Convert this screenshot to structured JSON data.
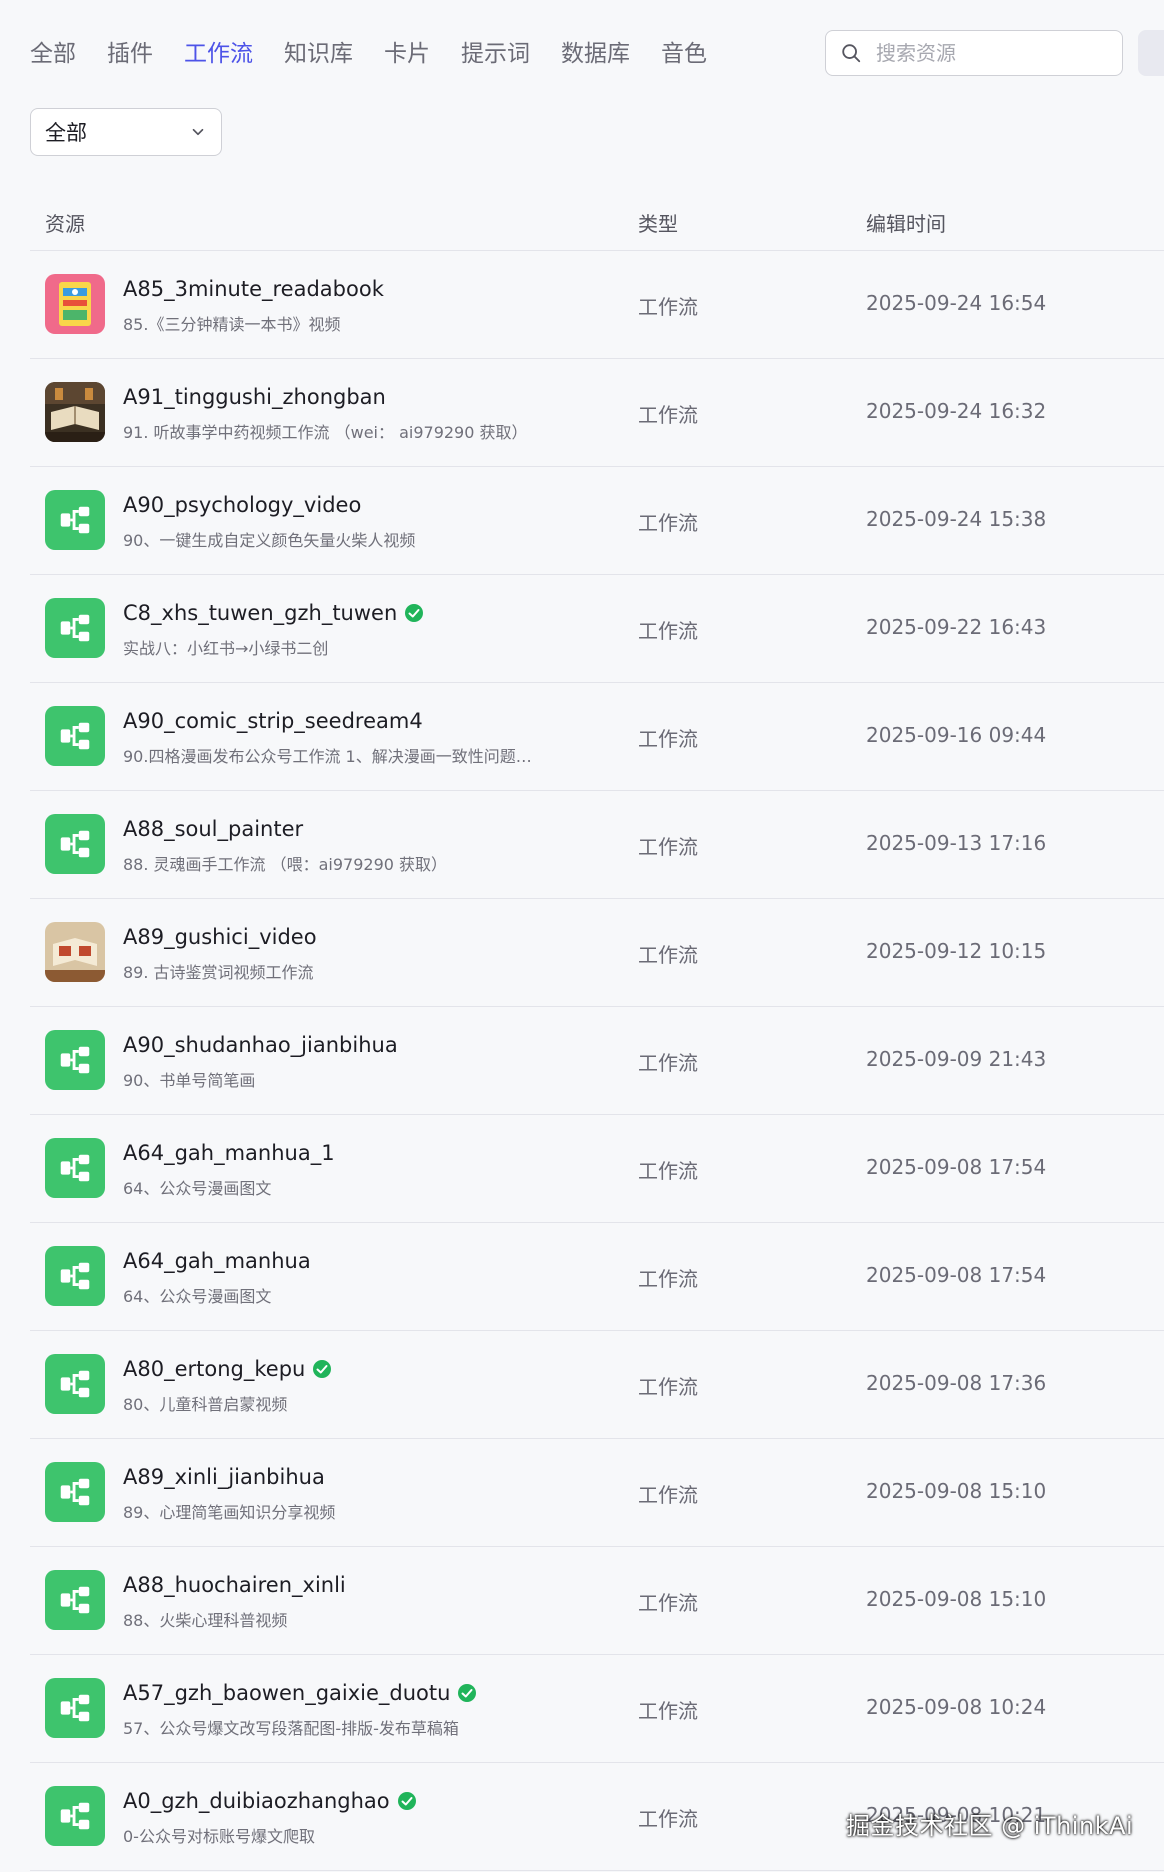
{
  "tabs": [
    {
      "label": "全部",
      "active": false
    },
    {
      "label": "插件",
      "active": false
    },
    {
      "label": "工作流",
      "active": true
    },
    {
      "label": "知识库",
      "active": false
    },
    {
      "label": "卡片",
      "active": false
    },
    {
      "label": "提示词",
      "active": false
    },
    {
      "label": "数据库",
      "active": false
    },
    {
      "label": "音色",
      "active": false
    }
  ],
  "search": {
    "placeholder": "搜索资源",
    "value": ""
  },
  "filter": {
    "selected": "全部"
  },
  "table": {
    "headers": {
      "resource": "资源",
      "type": "类型",
      "edit_time": "编辑时间"
    },
    "rows": [
      {
        "title": "A85_3minute_readabook",
        "desc": "85.《三分钟精读一本书》视频",
        "type": "工作流",
        "time": "2025-09-24 16:54",
        "icon": "book-thumbnail",
        "verified": false
      },
      {
        "title": "A91_tinggushi_zhongban",
        "desc": "91. 听故事学中药视频工作流 （wei： ai979290 获取）",
        "type": "工作流",
        "time": "2025-09-24 16:32",
        "icon": "herb-book-thumbnail",
        "verified": false
      },
      {
        "title": "A90_psychology_video",
        "desc": "90、一键生成自定义颜色矢量火柴人视频",
        "type": "工作流",
        "time": "2025-09-24 15:38",
        "icon": "workflow-icon",
        "verified": false
      },
      {
        "title": "C8_xhs_tuwen_gzh_tuwen",
        "desc": "实战八：小红书→小绿书二创",
        "type": "工作流",
        "time": "2025-09-22 16:43",
        "icon": "workflow-icon",
        "verified": true
      },
      {
        "title": "A90_comic_strip_seedream4",
        "desc": "90.四格漫画发布公众号工作流 1、解决漫画一致性问题…",
        "type": "工作流",
        "time": "2025-09-16 09:44",
        "icon": "workflow-icon",
        "verified": false
      },
      {
        "title": "A88_soul_painter",
        "desc": "88. 灵魂画手工作流 （喂：ai979290 获取）",
        "type": "工作流",
        "time": "2025-09-13 17:16",
        "icon": "workflow-icon",
        "verified": false
      },
      {
        "title": "A89_gushici_video",
        "desc": "89. 古诗鉴赏词视频工作流",
        "type": "工作流",
        "time": "2025-09-12 10:15",
        "icon": "poetry-book-thumbnail",
        "verified": false
      },
      {
        "title": "A90_shudanhao_jianbihua",
        "desc": "90、书单号简笔画",
        "type": "工作流",
        "time": "2025-09-09 21:43",
        "icon": "workflow-icon",
        "verified": false
      },
      {
        "title": "A64_gah_manhua_1",
        "desc": "64、公众号漫画图文",
        "type": "工作流",
        "time": "2025-09-08 17:54",
        "icon": "workflow-icon",
        "verified": false
      },
      {
        "title": "A64_gah_manhua",
        "desc": "64、公众号漫画图文",
        "type": "工作流",
        "time": "2025-09-08 17:54",
        "icon": "workflow-icon",
        "verified": false
      },
      {
        "title": "A80_ertong_kepu",
        "desc": "80、儿童科普启蒙视频",
        "type": "工作流",
        "time": "2025-09-08 17:36",
        "icon": "workflow-icon",
        "verified": true
      },
      {
        "title": "A89_xinli_jianbihua",
        "desc": "89、心理简笔画知识分享视频",
        "type": "工作流",
        "time": "2025-09-08 15:10",
        "icon": "workflow-icon",
        "verified": false
      },
      {
        "title": "A88_huochairen_xinli",
        "desc": "88、火柴心理科普视频",
        "type": "工作流",
        "time": "2025-09-08 15:10",
        "icon": "workflow-icon",
        "verified": false
      },
      {
        "title": "A57_gzh_baowen_gaixie_duotu",
        "desc": "57、公众号爆文改写段落配图-排版-发布草稿箱",
        "type": "工作流",
        "time": "2025-09-08 10:24",
        "icon": "workflow-icon",
        "verified": true
      },
      {
        "title": "A0_gzh_duibiaozhanghao",
        "desc": "0-公众号对标账号爆文爬取",
        "type": "工作流",
        "time": "2025-09-08 10:21",
        "icon": "workflow-icon",
        "verified": true
      }
    ]
  },
  "watermark": "掘金技术社区 @ iThinkAi",
  "colors": {
    "accent": "#4d53e8",
    "workflow_green": "#3ec46d",
    "verified_green": "#20b45a"
  }
}
